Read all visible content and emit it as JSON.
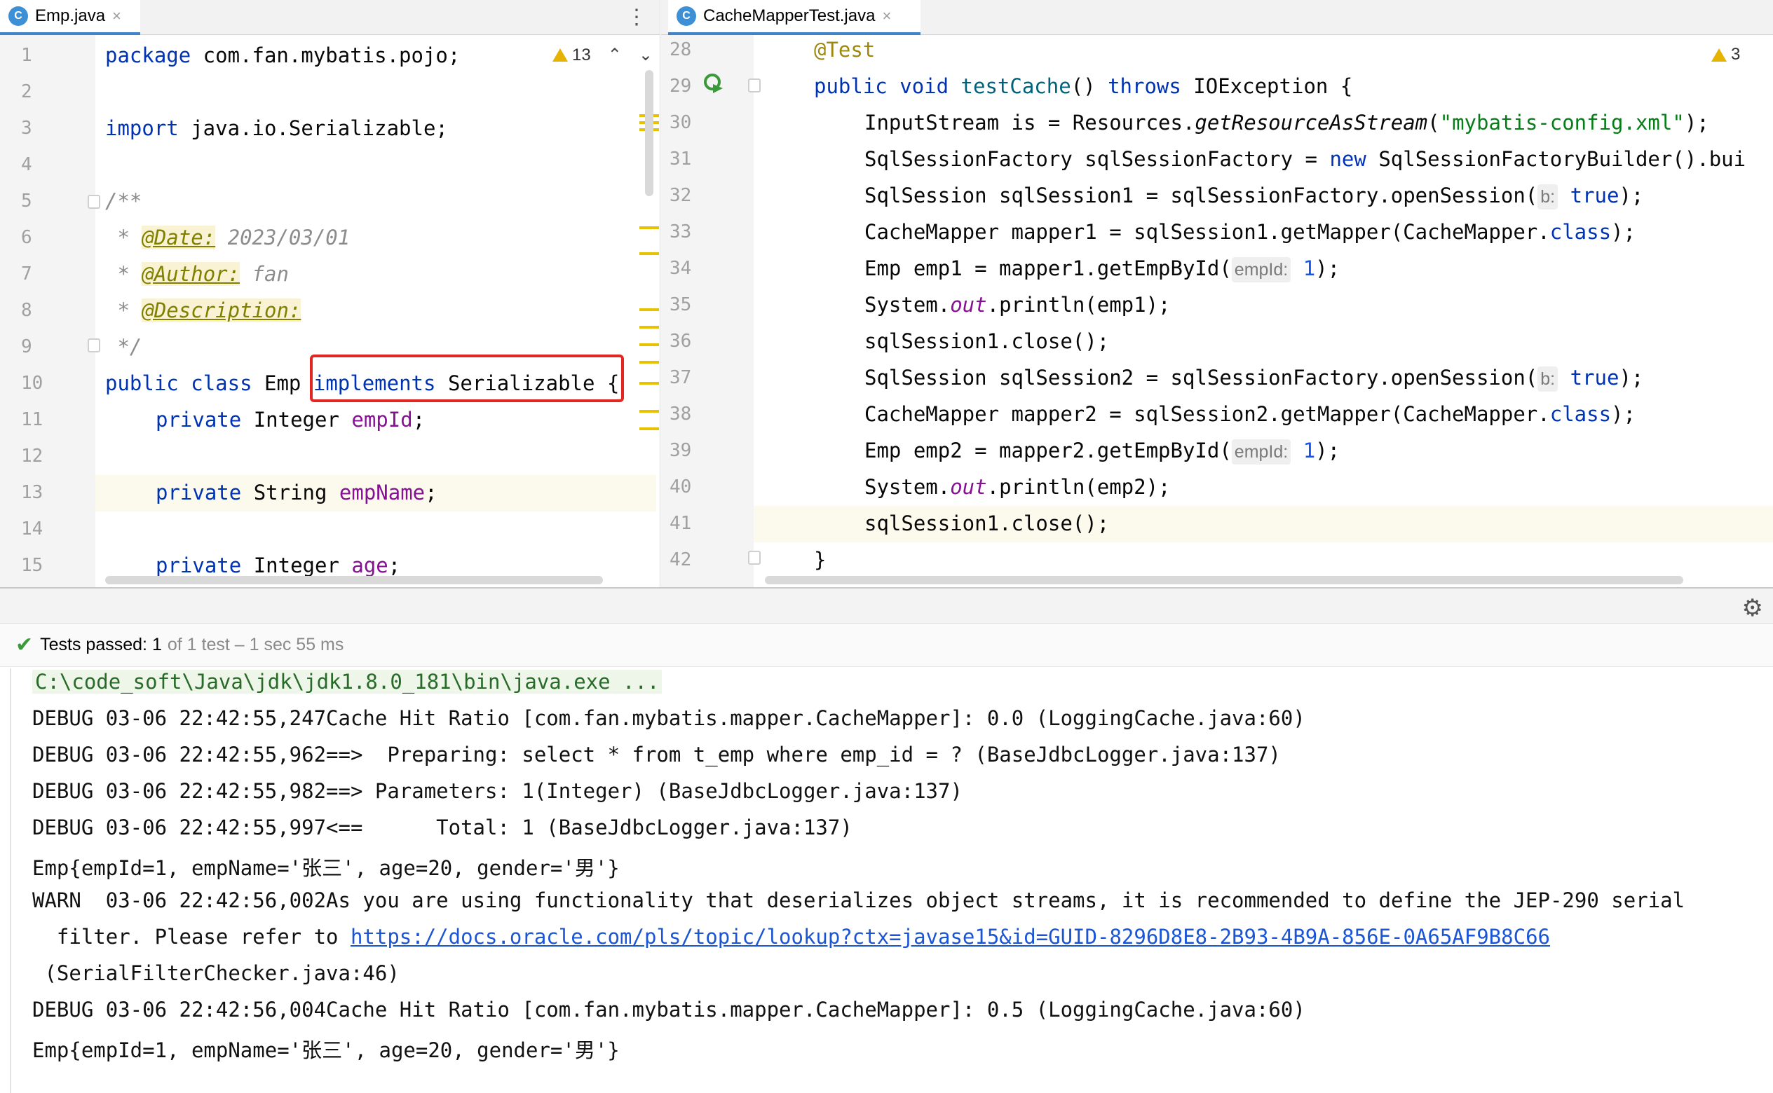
{
  "left_editor": {
    "tab_label": "Emp.java",
    "tab_icon": "C",
    "warnings": "13",
    "line_numbers": [
      "1",
      "2",
      "3",
      "4",
      "5",
      "6",
      "7",
      "8",
      "9",
      "10",
      "11",
      "12",
      "13",
      "14",
      "15"
    ],
    "code": {
      "l1_kw": "package",
      "l1_rest": " com.fan.mybatis.pojo;",
      "l3_kw": "import",
      "l3_rest": " java.io.Serializable;",
      "l5": "/**",
      "l6_star": " * ",
      "l6_tag": "@Date:",
      "l6_val": " 2023/03/01",
      "l7_star": " * ",
      "l7_tag": "@Author:",
      "l7_val": " fan",
      "l8_star": " * ",
      "l8_tag": "@Description:",
      "l9": " */",
      "l10_kw1": "public",
      "l10_kw2": "class",
      "l10_name": "Emp",
      "l10_kw3": "implements",
      "l10_iface": "Serializable",
      "l10_brace": "{",
      "l11_kw": "private",
      "l11_type": "Integer",
      "l11_field": "empId",
      "l11_end": ";",
      "l13_kw": "private",
      "l13_type": "String",
      "l13_field": "empName",
      "l13_end": ";",
      "l15_kw": "private",
      "l15_type": "Integer",
      "l15_field": "age",
      "l15_end": ";"
    }
  },
  "right_editor": {
    "tab_label": "CacheMapperTest.java",
    "tab_icon": "C",
    "warnings": "3",
    "line_numbers": [
      "28",
      "29",
      "30",
      "31",
      "32",
      "33",
      "34",
      "35",
      "36",
      "37",
      "38",
      "39",
      "40",
      "41",
      "42"
    ],
    "code": {
      "l28": "@Test",
      "l29_kw1": "public",
      "l29_kw2": "void",
      "l29_name": "testCache",
      "l29_paren": "()",
      "l29_kw3": "throws",
      "l29_rest": " IOException {",
      "l30_a": "InputStream is = Resources.",
      "l30_m": "getResourceAsStream",
      "l30_b": "(",
      "l30_s": "\"mybatis-config.xml\"",
      "l30_c": ");",
      "l31_a": "SqlSessionFactory sqlSessionFactory = ",
      "l31_kw": "new",
      "l31_b": " SqlSessionFactoryBuilder().bui",
      "l32_a": "SqlSession sqlSession1 = sqlSessionFactory.openSession(",
      "l32_hint": "b:",
      "l32_v": "true",
      "l32_c": ");",
      "l33_a": "CacheMapper mapper1 = sqlSession1.getMapper(CacheMapper.",
      "l33_kw": "class",
      "l33_c": ");",
      "l34_a": "Emp emp1 = mapper1.getEmpById(",
      "l34_hint": "empId:",
      "l34_v": "1",
      "l34_c": ");",
      "l35_a": "System.",
      "l35_f": "out",
      "l35_c": ".println(emp1);",
      "l36": "sqlSession1.close();",
      "l37_a": "SqlSession sqlSession2 = sqlSessionFactory.openSession(",
      "l37_hint": "b:",
      "l37_v": "true",
      "l37_c": ");",
      "l38_a": "CacheMapper mapper2 = sqlSession2.getMapper(CacheMapper.",
      "l38_kw": "class",
      "l38_c": ");",
      "l39_a": "Emp emp2 = mapper2.getEmpById(",
      "l39_hint": "empId:",
      "l39_v": "1",
      "l39_c": ");",
      "l40_a": "System.",
      "l40_f": "out",
      "l40_c": ".println(emp2);",
      "l41": "sqlSession1.close();",
      "l42": "}"
    }
  },
  "run_panel": {
    "status_bold": "Tests passed: 1",
    "status_gray": "of 1 test – 1 sec 55 ms",
    "console_lines": [
      "C:\\code_soft\\Java\\jdk\\jdk1.8.0_181\\bin\\java.exe ...",
      "DEBUG 03-06 22:42:55,247Cache Hit Ratio [com.fan.mybatis.mapper.CacheMapper]: 0.0 (LoggingCache.java:60)",
      "DEBUG 03-06 22:42:55,962==>  Preparing: select * from t_emp where emp_id = ? (BaseJdbcLogger.java:137)",
      "DEBUG 03-06 22:42:55,982==> Parameters: 1(Integer) (BaseJdbcLogger.java:137)",
      "DEBUG 03-06 22:42:55,997<==      Total: 1 (BaseJdbcLogger.java:137)",
      "Emp{empId=1, empName='张三', age=20, gender='男'}",
      "WARN  03-06 22:42:56,002As you are using functionality that deserializes object streams, it is recommended to define the JEP-290 serial",
      "  filter. Please refer to ",
      " (SerialFilterChecker.java:46)",
      "DEBUG 03-06 22:42:56,004Cache Hit Ratio [com.fan.mybatis.mapper.CacheMapper]: 0.5 (LoggingCache.java:60)",
      "Emp{empId=1, empName='张三', age=20, gender='男'}"
    ],
    "console_link": "https://docs.oracle.com/pls/topic/lookup?ctx=javase15&id=GUID-8296D8E8-2B93-4B9A-856E-0A65AF9B8C66"
  }
}
